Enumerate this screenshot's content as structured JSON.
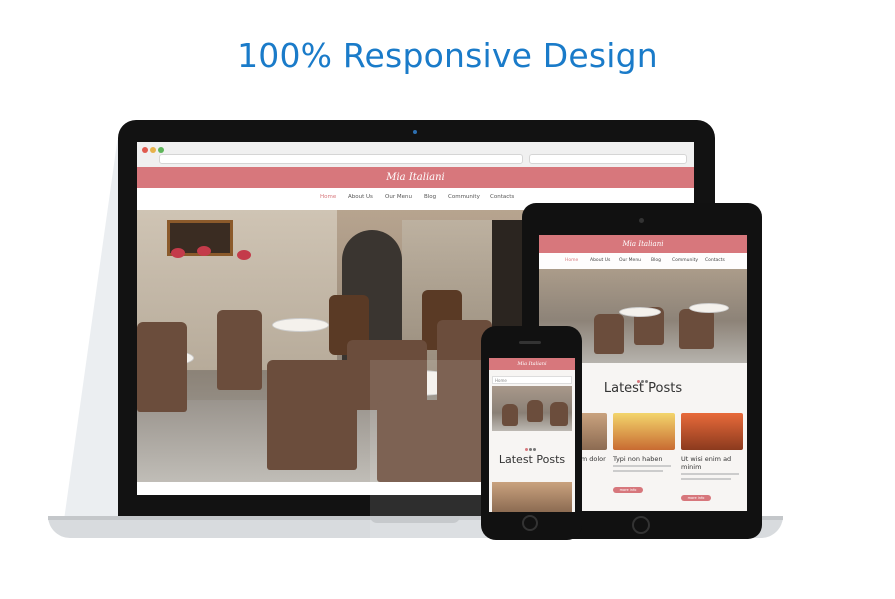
{
  "headline": "100% Responsive Design",
  "colors": {
    "accent": "#1a7bc9",
    "brand_pink": "#d7777c"
  },
  "laptop": {
    "logo": "Mia Italiani",
    "nav": [
      "Home",
      "About Us",
      "Our Menu",
      "Blog",
      "Community",
      "Contacts"
    ]
  },
  "tablet": {
    "logo": "Mia Italiani",
    "nav": [
      "Home",
      "About Us",
      "Our Menu",
      "Blog",
      "Community",
      "Contacts"
    ],
    "heading": "Latest Posts",
    "posts": [
      {
        "title": "Lorem ipsum dolor",
        "more": "more info"
      },
      {
        "title": "Typi non haben",
        "more": "more info"
      },
      {
        "title": "Ut wisi enim ad minim",
        "more": "more info"
      }
    ]
  },
  "phone": {
    "logo": "Mia Italiani",
    "nav": "Home",
    "heading": "Latest Posts"
  }
}
